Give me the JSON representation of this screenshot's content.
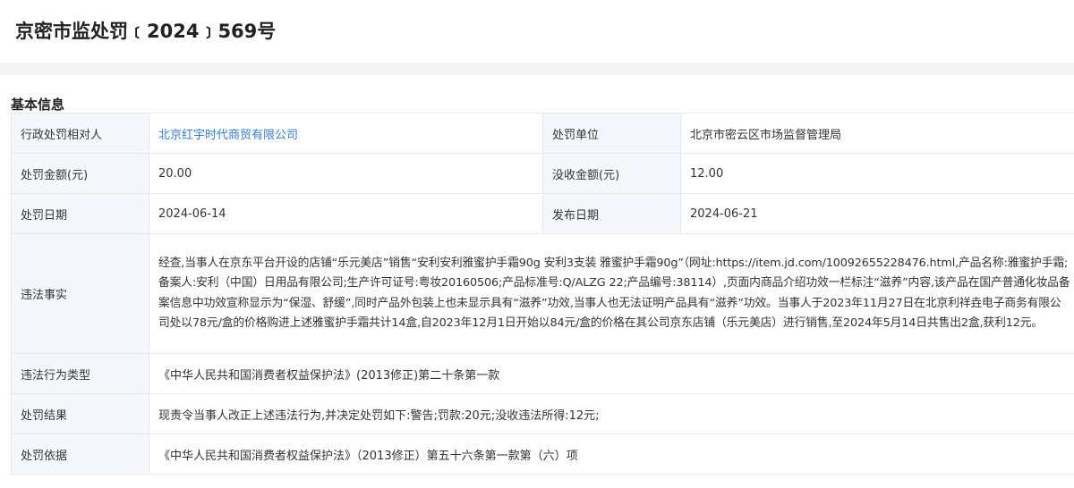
{
  "page": {
    "title": "京密市监处罚﹝2024﹞569号"
  },
  "section": {
    "title": "基本信息"
  },
  "rows": {
    "subject_label": "行政处罚相对人",
    "subject_value": "北京红宇时代商贸有限公司",
    "unit_label": "处罚单位",
    "unit_value": "北京市密云区市场监督管理局",
    "fine_label": "处罚金额(元)",
    "fine_value": "20.00",
    "confiscation_label": "没收金额(元)",
    "confiscation_value": "12.00",
    "date_label": "处罚日期",
    "date_value": "2024-06-14",
    "publish_label": "发布日期",
    "publish_value": "2024-06-21",
    "facts_label": "违法事实",
    "facts_value": "经查,当事人在京东平台开设的店铺“乐元美店”销售“安利安利雅蜜护手霜90g 安利3支装 雅蜜护手霜90g”（网址:https://item.jd.com/10092655228476.html,产品名称:雅蜜护手霜;备案人:安利（中国）日用品有限公司;生产许可证号:粤妆20160506;产品标准号:Q/ALZG 22;产品编号:38114）,页面内商品介绍功效一栏标注“滋养”内容,该产品在国产普通化妆品备案信息中功效宣称显示为“保湿、舒缓”,同时产品外包装上也未显示具有“滋养”功效,当事人也无法证明产品具有“滋养”功效。当事人于2023年11月27日在北京利祥垚电子商务有限公司处以78元/盒的价格购进上述雅蜜护手霜共计14盒,自2023年12月1日开始以84元/盒的价格在其公司京东店铺（乐元美店）进行销售,至2024年5月14日共售出2盒,获利12元。",
    "violation_type_label": "违法行为类型",
    "violation_type_value": "《中华人民共和国消费者权益保护法》(2013修正)第二十条第一款",
    "result_label": "处罚结果",
    "result_value": "现责令当事人改正上述违法行为,并决定处罚如下:警告;罚款:20元;没收违法所得:12元;",
    "basis_label": "处罚依据",
    "basis_value": "《中华人民共和国消费者权益保护法》（2013修正）第五十六条第一款第（六）项"
  },
  "colors": {
    "label_bg": "#f4f8fd",
    "link": "#2f7fd8",
    "border": "#e8e8e8"
  }
}
